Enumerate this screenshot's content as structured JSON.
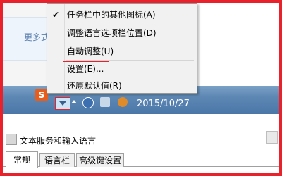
{
  "background": {
    "more_text": "更多式"
  },
  "taskbar": {
    "ime_icon_label": "S",
    "date": "2015/10/27"
  },
  "context_menu": {
    "items": [
      {
        "label": "任务栏中的其他图标(A)",
        "checked": true
      },
      {
        "label": "调整语言选项栏位置(D)",
        "checked": false
      },
      {
        "label": "自动调整(U)",
        "checked": false
      },
      {
        "label": "设置(E)...",
        "checked": false,
        "highlighted": true
      },
      {
        "label": "还原默认值(R)",
        "checked": false
      }
    ],
    "check_glyph": "✔"
  },
  "dialog": {
    "title": "文本服务和输入语言",
    "tabs": [
      {
        "label": "常规",
        "active": true
      },
      {
        "label": "语言栏",
        "active": false
      },
      {
        "label": "高级键设置",
        "active": false
      }
    ]
  },
  "colors": {
    "highlight_border": "#e8212b",
    "taskbar": "#5d86b3"
  }
}
